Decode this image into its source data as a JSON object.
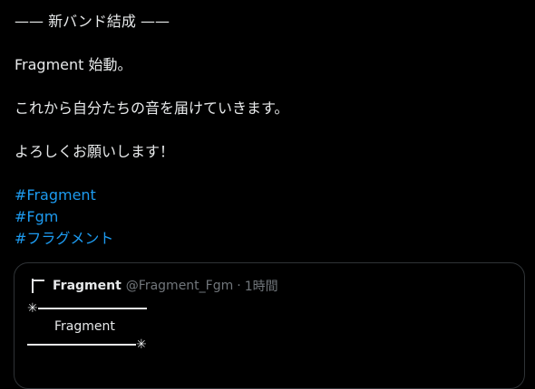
{
  "post": {
    "lines": [
      "—— 新バンド結成 ——",
      "",
      "Fragment 始動。",
      "",
      "これから自分たちの音を届けていきます。",
      "",
      "よろしくお願いします！",
      ""
    ],
    "hashtags": [
      "#Fragment",
      "#Fgm",
      "#フラグメント"
    ]
  },
  "quote": {
    "avatar_icon": "flag-icon",
    "display_name": "Fragment",
    "handle": "@Fragment_Fgm",
    "separator": "·",
    "time": "1時間",
    "deco_star": "✳",
    "text": "Fragment"
  },
  "colors": {
    "background": "#000000",
    "text": "#e7e9ea",
    "link": "#1d9bf0",
    "muted": "#71767b",
    "border": "#2f3336"
  }
}
